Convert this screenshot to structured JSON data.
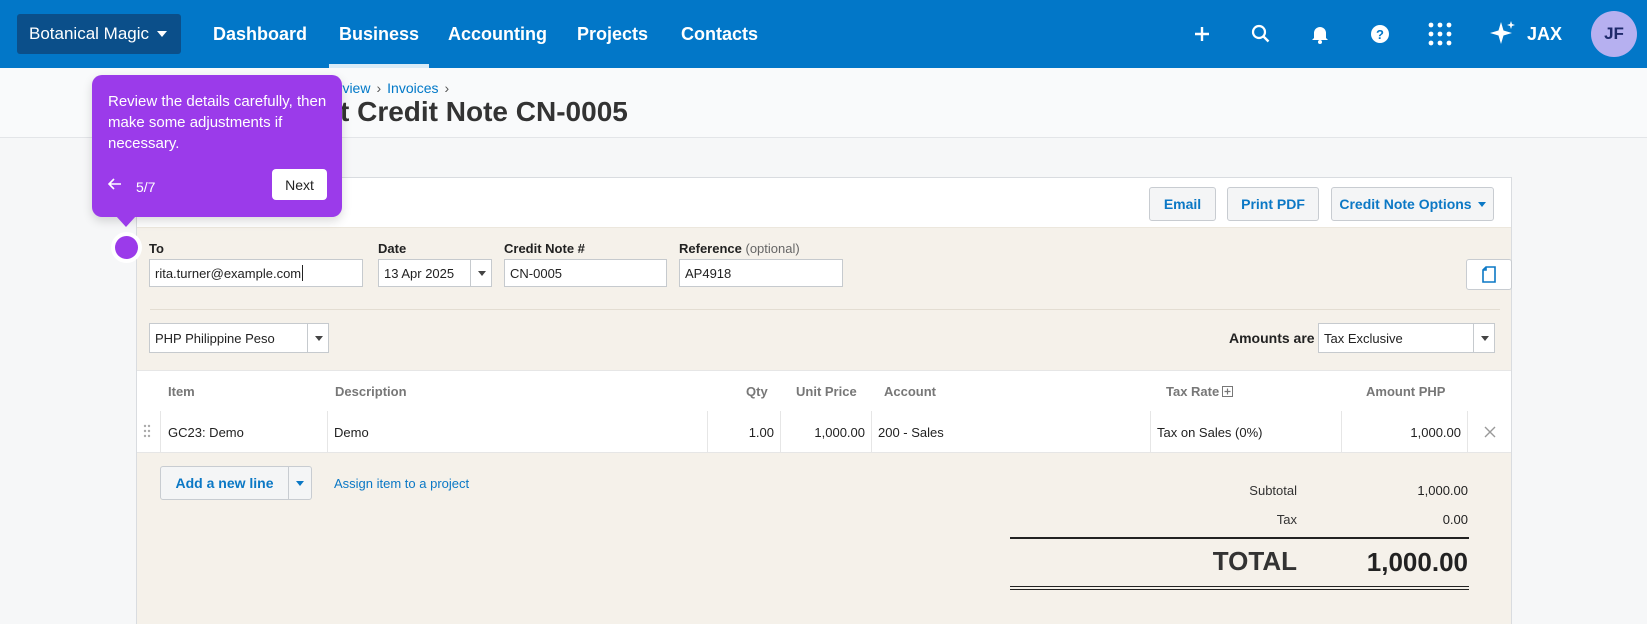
{
  "nav": {
    "org_name": "Botanical Magic",
    "links": [
      {
        "label": "Dashboard"
      },
      {
        "label": "Business"
      },
      {
        "label": "Accounting"
      },
      {
        "label": "Projects"
      },
      {
        "label": "Contacts"
      }
    ],
    "active": "Business",
    "jax_label": "JAX",
    "avatar_initials": "JF",
    "icons": [
      "plus-icon",
      "search-icon",
      "bell-icon",
      "help-icon",
      "apps-grid-icon",
      "sparkle-icon"
    ],
    "brand_color": "#0277c8"
  },
  "breadcrumb": {
    "items": [
      "erview",
      "Invoices"
    ]
  },
  "page": {
    "title": "Credit Note CN-0005",
    "title_prefix": "t"
  },
  "toolbar": {
    "email": "Email",
    "print_pdf": "Print PDF",
    "options": "Credit Note Options"
  },
  "form": {
    "to_label": "To",
    "to_value": "rita.turner@example.com",
    "date_label": "Date",
    "date_value": "13 Apr 2025",
    "number_label": "Credit Note #",
    "number_value": "CN-0005",
    "reference_label": "Reference",
    "reference_optional": "(optional)",
    "reference_value": "AP4918",
    "currency_value": "PHP Philippine Peso",
    "amounts_are_label": "Amounts are",
    "amounts_are_value": "Tax Exclusive"
  },
  "table": {
    "headers": {
      "item": "Item",
      "description": "Description",
      "qty": "Qty",
      "unit_price": "Unit Price",
      "account": "Account",
      "tax_rate": "Tax Rate",
      "amount": "Amount PHP"
    },
    "rows": [
      {
        "item": "GC23: Demo",
        "description": "Demo",
        "qty": "1.00",
        "unit_price": "1,000.00",
        "account": "200 - Sales",
        "tax_rate": "Tax on Sales (0%)",
        "amount": "1,000.00"
      }
    ]
  },
  "actions": {
    "add_line": "Add a new line",
    "assign_project": "Assign item to a project"
  },
  "totals": {
    "subtotal_label": "Subtotal",
    "subtotal_value": "1,000.00",
    "tax_label": "Tax",
    "tax_value": "0.00",
    "total_label": "TOTAL",
    "total_value": "1,000.00"
  },
  "tooltip": {
    "message": "Review the details carefully, then make some adjustments if necessary.",
    "step": "5/7",
    "next_label": "Next",
    "color": "#9b3bea"
  }
}
